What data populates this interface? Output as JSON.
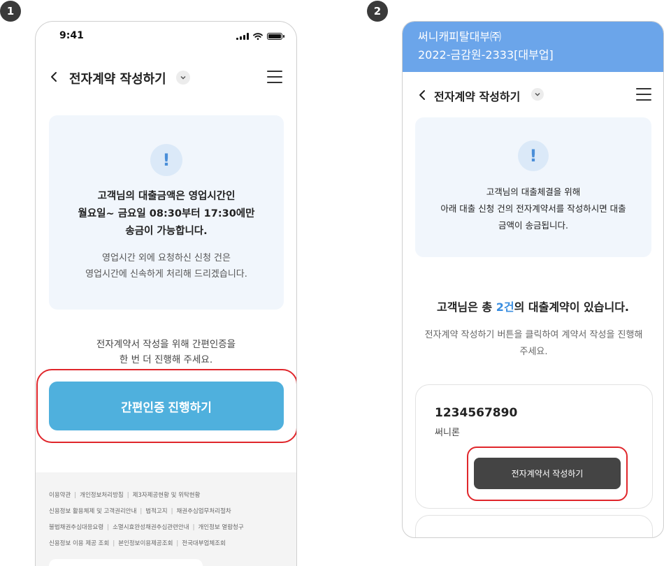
{
  "badges": [
    "1",
    "2"
  ],
  "phone1": {
    "status_time": "9:41",
    "header": {
      "title": "전자계약 작성하기"
    },
    "info": {
      "main_lines": [
        "고객님의 대출금액은 영업시간인",
        "월요일~ 금요일 08:30부터 17:30에만",
        "송금이 가능합니다."
      ],
      "sub_lines": [
        "영업시간 외에 요청하신 신청 건은",
        "영업시간에 신속하게 처리해 드리겠습니다."
      ]
    },
    "cert_lines": [
      "전자계약서 작성을 위해 간편인증을",
      "한 번 더 진행해 주세요."
    ],
    "cta_label": "간편인증 진행하기",
    "footer_rows": [
      [
        "이용약관",
        "개인정보처리방침",
        "제3자제공현황 및 위탁현황"
      ],
      [
        "신용정보 활용체제 및 고객권리안내",
        "법적고지",
        "채권추심업무처리절차"
      ],
      [
        "불법채권추심대응요령",
        "소멸시효완성채권추심관련안내",
        "개인정보 열람청구"
      ],
      [
        "신용정보 이용 제공 조회",
        "본인정보이용제공조회",
        "전국대부업체조회"
      ]
    ]
  },
  "phone2": {
    "banner": {
      "company": "써니캐피탈대부㈜",
      "reg_no": "2022-금감원-2333[대부업]"
    },
    "header": {
      "title": "전자계약 작성하기"
    },
    "info_lines": [
      "고객님의 대출체결을 위해",
      "아래 대출 신청 건의 전자계약서를 작성하시면 대출",
      "금액이 송금됩니다."
    ],
    "count": {
      "prefix": "고객님은 총 ",
      "number": "2건",
      "suffix": "의 대출계약이 있습니다."
    },
    "guide_lines": [
      "전자계약 작성하기 버튼을 클릭하여 계약서 작성을 진행해",
      "주세요."
    ],
    "contract": {
      "number": "1234567890",
      "product": "써니론",
      "button_label": "전자계약서 작성하기"
    }
  },
  "colors": {
    "cta_blue": "#4fb0dd",
    "banner_blue": "#6ba5ea",
    "highlight_red": "#e0262b",
    "count_blue": "#3a8ee0"
  },
  "icons": [
    "back-chevron-icon",
    "dropdown-chevron-icon",
    "hamburger-menu-icon",
    "exclamation-icon",
    "signal-icon",
    "wifi-icon",
    "battery-icon"
  ]
}
